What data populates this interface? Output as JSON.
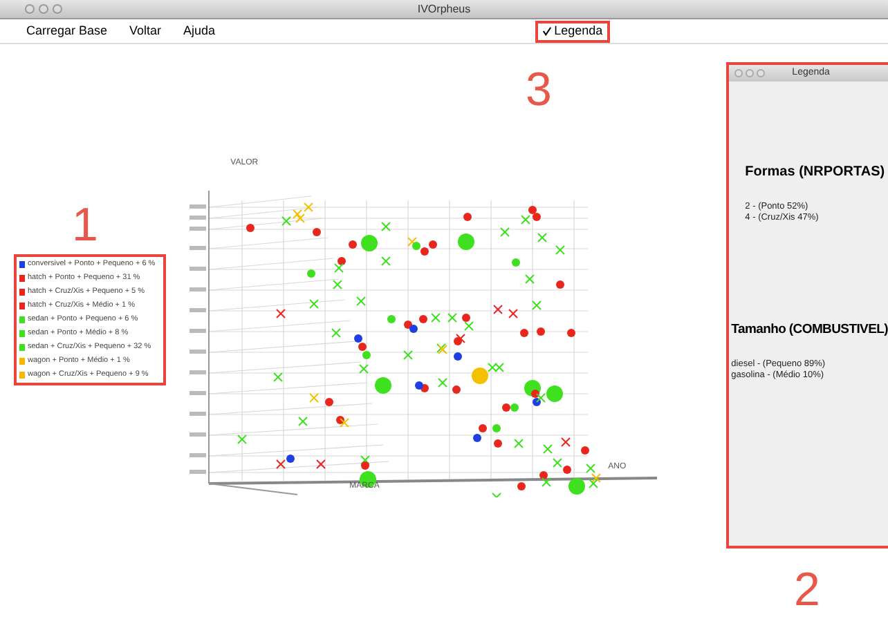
{
  "window": {
    "title": "IVOrpheus"
  },
  "menu": [
    {
      "label": "Carregar Base",
      "checked": false,
      "highlighted": false
    },
    {
      "label": "Voltar",
      "checked": false,
      "highlighted": false
    },
    {
      "label": "Ajuda",
      "checked": false,
      "highlighted": false
    },
    {
      "label": "Legenda",
      "checked": true,
      "highlighted": true
    }
  ],
  "legend": {
    "items": [
      {
        "label": "conversivel + Ponto + Pequeno +  6 %",
        "color": "#1f3fe0"
      },
      {
        "label": "hatch + Ponto + Pequeno +  31 %",
        "color": "#e8261c"
      },
      {
        "label": "hatch + Cruz/Xis + Pequeno +  5 %",
        "color": "#e8261c"
      },
      {
        "label": "hatch + Cruz/Xis + Médio +  1 %",
        "color": "#e8261c"
      },
      {
        "label": "sedan + Ponto + Pequeno +  6 %",
        "color": "#3fe01f"
      },
      {
        "label": "sedan + Ponto + Médio +  8 %",
        "color": "#3fe01f"
      },
      {
        "label": "sedan + Cruz/Xis + Pequeno +  32 %",
        "color": "#3fe01f"
      },
      {
        "label": "wagon + Ponto + Médio +  1 %",
        "color": "#f5b800"
      },
      {
        "label": "wagon + Cruz/Xis + Pequeno +  9 %",
        "color": "#f5b800"
      }
    ]
  },
  "plot": {
    "y_axis_label": "VALOR",
    "x_axis_label": "MARCA",
    "z_axis_label": "ANO"
  },
  "legend_window": {
    "title": "Legenda",
    "sections": [
      {
        "heading": "Formas (NRPORTAS)",
        "lines": [
          "2 - (Ponto 52%)",
          "4 - (Cruz/Xis 47%)"
        ]
      },
      {
        "heading": "Tamanho (COMBUSTIVEL)",
        "lines": [
          "diesel - (Pequeno 89%)",
          "gasolina - (Médio 10%)"
        ]
      }
    ]
  },
  "annotations": [
    {
      "label": "1"
    },
    {
      "label": "3"
    },
    {
      "label": "2"
    }
  ]
}
